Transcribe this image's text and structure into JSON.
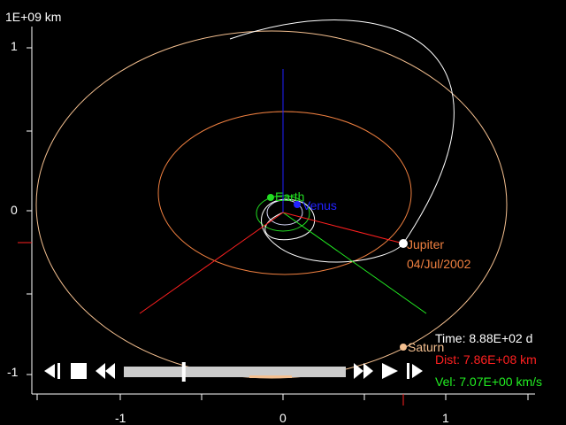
{
  "axes": {
    "unit_label": "1E+09 km",
    "y_ticks": [
      "1",
      "0",
      "-1"
    ],
    "x_ticks": [
      "-1",
      "0",
      "1"
    ]
  },
  "bodies": {
    "earth": {
      "name": "Earth",
      "color": "#22dd22"
    },
    "venus": {
      "name": "Venus",
      "color": "#2222ff"
    },
    "jupiter": {
      "name": "Jupiter",
      "date": "04/Jul/2002",
      "color": "#f08040"
    },
    "saturn": {
      "name": "Saturn",
      "color": "#f5c090"
    }
  },
  "readouts": {
    "time": "Time: 8.88E+02 d",
    "dist": "Dist: 7.86E+08 km",
    "vel": "Vel: 7.07E+00 km/s",
    "time_color": "#ffffff",
    "dist_color": "#ff2020",
    "vel_color": "#22ee22"
  },
  "playback": {
    "position_fraction": 0.27,
    "controls": [
      "skip-to-start-icon",
      "stop-icon",
      "rewind-icon",
      "fast-forward-icon",
      "play-icon",
      "skip-to-end-icon"
    ]
  }
}
